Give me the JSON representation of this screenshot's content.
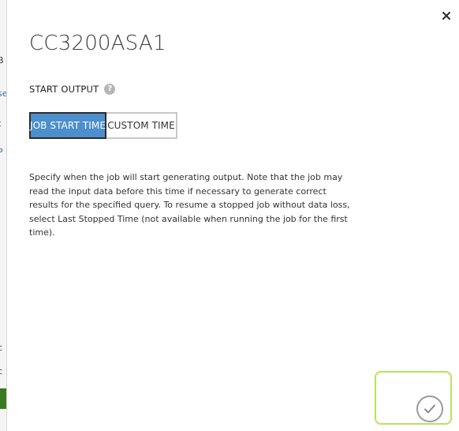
{
  "dialog": {
    "title": "CC3200ASA1",
    "close_icon": "close-icon",
    "start_output": {
      "label": "START OUTPUT",
      "help_icon": "help-icon",
      "help_glyph": "?",
      "options": [
        {
          "label": "JOB START TIME",
          "selected": true
        },
        {
          "label": "CUSTOM TIME",
          "selected": false
        }
      ]
    },
    "description": "Specify when the job will start generating output. Note that the job may read the input data before this time if necessary to generate correct results for the specified query. To resume a stopped job without data loss, select Last Stopped Time (not available when running the job for the first time).",
    "confirm_icon": "checkmark-icon"
  },
  "background": {
    "fragments": [
      "B",
      "se",
      "t",
      "P",
      "c",
      "c"
    ]
  },
  "colors": {
    "selected_bg": "#4d8fcc",
    "confirm_highlight": "#b9e25a",
    "help_icon_bg": "#b5b5b5"
  }
}
